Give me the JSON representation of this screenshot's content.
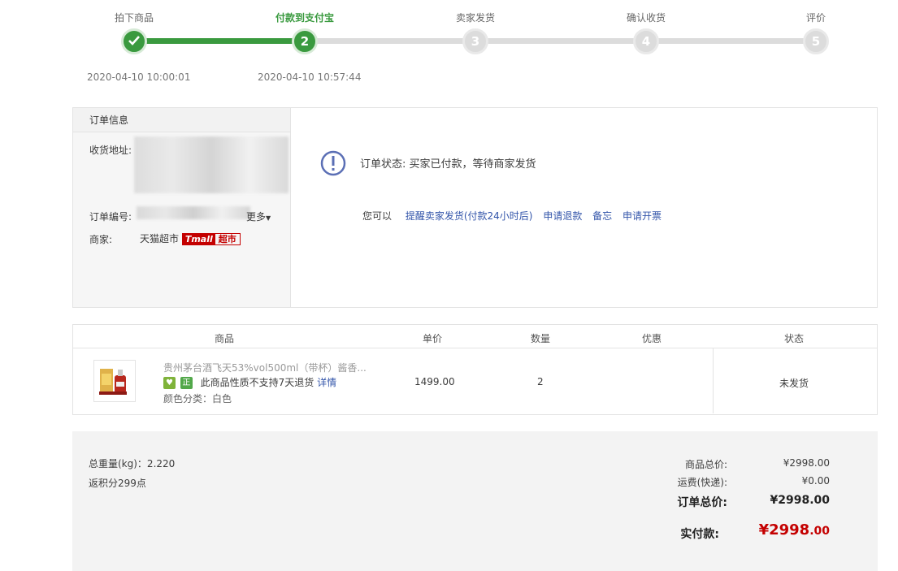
{
  "progress": {
    "steps": [
      {
        "label": "拍下商品",
        "num": "1",
        "state": "done"
      },
      {
        "label": "付款到支付宝",
        "num": "2",
        "state": "active"
      },
      {
        "label": "卖家发货",
        "num": "3",
        "state": "todo"
      },
      {
        "label": "确认收货",
        "num": "4",
        "state": "todo"
      },
      {
        "label": "评价",
        "num": "5",
        "state": "todo"
      }
    ],
    "times": [
      "2020-04-10 10:00:01",
      "2020-04-10 10:57:44"
    ]
  },
  "order_info": {
    "title": "订单信息",
    "address_label": "收货地址:",
    "order_no_label": "订单编号:",
    "more_label": "更多",
    "seller_label": "商家:",
    "seller_name": "天猫超市",
    "badge_tmall": "Tmall",
    "badge_market": "超市"
  },
  "status": {
    "text": "订单状态: 买家已付款，等待商家发货",
    "actions_prefix": "您可以",
    "actions": [
      "提醒卖家发货(付款24小时后)",
      "申请退款",
      "备忘",
      "申请开票"
    ]
  },
  "goods_table": {
    "headers": [
      "商品",
      "单价",
      "数量",
      "优惠",
      "状态"
    ],
    "item": {
      "title": "贵州茅台酒飞天53%vol500ml（带杯）酱香...",
      "tag1": "♥",
      "tag2": "正",
      "return_note": "此商品性质不支持7天退货",
      "detail_link": "详情",
      "sku": "颜色分类：白色",
      "unit_price": "1499.00",
      "quantity": "2",
      "discount": "",
      "status": "未发货"
    }
  },
  "totals": {
    "weight": "总重量(kg)：2.220",
    "points": "返积分299点",
    "goods_total_label": "商品总价:",
    "goods_total": "¥2998.00",
    "shipping_label": "运费(快递):",
    "shipping": "¥0.00",
    "order_total_label": "订单总价:",
    "order_total": "¥2998.00",
    "paid_label": "实付款:",
    "paid_main": "¥2998",
    "paid_cents": ".00"
  },
  "colors": {
    "accent_green": "#3a9a3f",
    "price_red": "#c40000",
    "link_blue": "#3355aa"
  }
}
